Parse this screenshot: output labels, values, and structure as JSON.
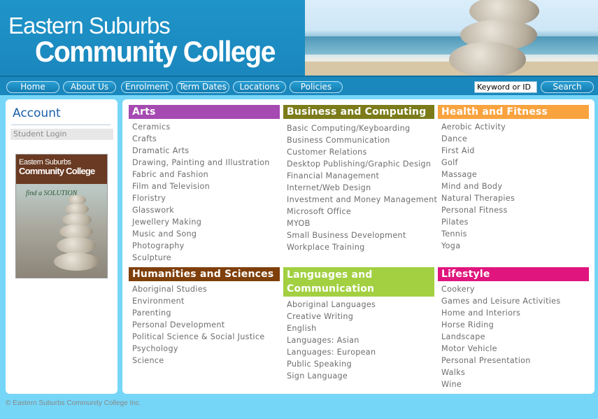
{
  "header": {
    "logo_line1": "Eastern Suburbs",
    "logo_line2": "Community College"
  },
  "nav": {
    "items": [
      {
        "label": "Home"
      },
      {
        "label": "About Us"
      },
      {
        "label": "Enrolment"
      },
      {
        "label": "Term Dates"
      },
      {
        "label": "Locations"
      },
      {
        "label": "Policies"
      }
    ],
    "search_value": "Keyword or ID",
    "search_button": "Search"
  },
  "sidebar": {
    "title": "Account",
    "login": "Student Login",
    "magazine": {
      "title_line1": "Eastern Suburbs",
      "title_line2": "Community College",
      "tagline": "find a SOLUTION"
    }
  },
  "colors": {
    "arts": "#a54ab1",
    "business": "#7b7b1a",
    "health": "#f9a33f",
    "humanities": "#7f3f0a",
    "languages": "#a2d041",
    "lifestyle": "#e0157d"
  },
  "categories": [
    {
      "title": "Arts",
      "items": [
        "Ceramics",
        "Crafts",
        "Dramatic Arts",
        "Drawing, Painting and Illustration",
        "Fabric and Fashion",
        "Film and Television",
        "Floristry",
        "Glasswork",
        "Jewellery Making",
        "Music and Song",
        "Photography",
        "Sculpture"
      ]
    },
    {
      "title": "Business and Computing",
      "items": [
        "Basic Computing/Keyboarding",
        "Business Communication",
        "Customer Relations",
        "Desktop Publishing/Graphic Design",
        "Financial Management",
        "Internet/Web Design",
        "Investment and Money Management",
        "Microsoft Office",
        "MYOB",
        "Small Business Development",
        "Workplace Training"
      ]
    },
    {
      "title": "Health and Fitness",
      "items": [
        "Aerobic Activity",
        "Dance",
        "First Aid",
        "Golf",
        "Massage",
        "Mind and Body",
        "Natural Therapies",
        "Personal Fitness",
        "Pilates",
        "Tennis",
        "Yoga"
      ]
    },
    {
      "title": "Humanities and Sciences",
      "items": [
        "Aboriginal Studies",
        "Environment",
        "Parenting",
        "Personal Development",
        "Political Science & Social Justice",
        "Psychology",
        "Science"
      ]
    },
    {
      "title": "Languages and Communication",
      "items": [
        "Aboriginal Languages",
        "Creative Writing",
        "English",
        "Languages: Asian",
        "Languages: European",
        "Public Speaking",
        "Sign Language"
      ]
    },
    {
      "title": "Lifestyle",
      "items": [
        "Cookery",
        "Games and Leisure Activities",
        "Home and Interiors",
        "Horse Riding",
        "Landscape",
        "Motor Vehicle",
        "Personal Presentation",
        "Walks",
        "Wine"
      ]
    }
  ],
  "footer": "© Eastern Suburbs Community College Inc."
}
